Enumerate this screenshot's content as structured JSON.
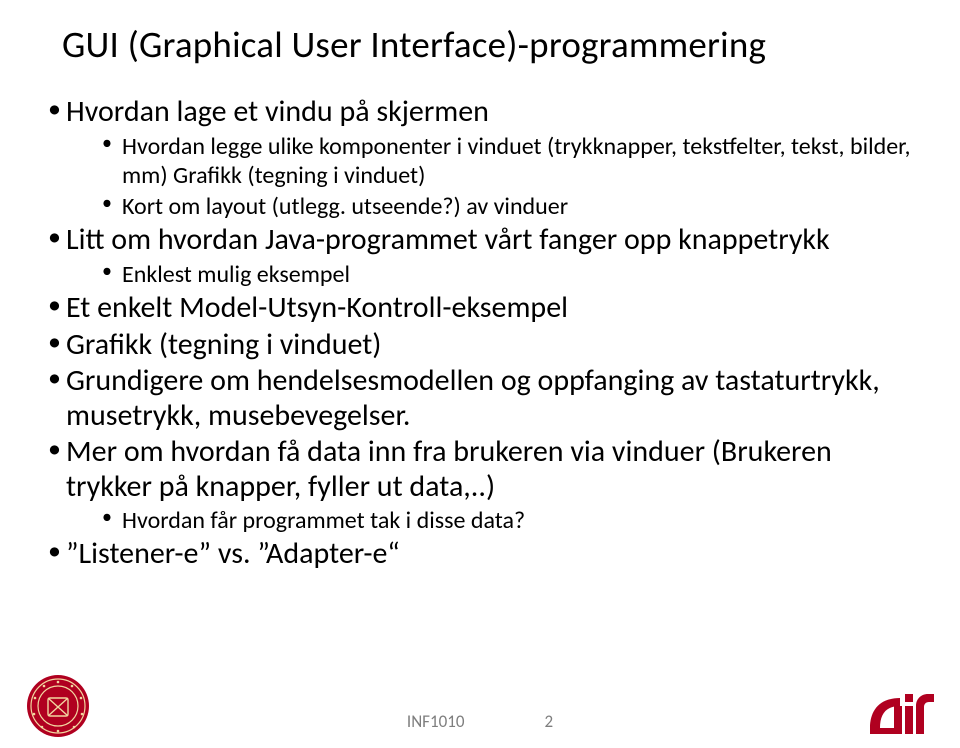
{
  "title": "GUI (Graphical User Interface)-programmering",
  "bullets": [
    {
      "text": "Hvordan lage et vindu på skjermen",
      "sub": [
        "Hvordan legge ulike komponenter i vinduet (trykknapper, tekstfelter, tekst, bilder, mm) Grafikk (tegning i vinduet)",
        "Kort om layout (utlegg. utseende?) av vinduer"
      ]
    },
    {
      "text": "Litt om hvordan Java-programmet vårt fanger opp knappetrykk",
      "sub": [
        "Enklest mulig eksempel"
      ]
    },
    {
      "text": "Et enkelt Model-Utsyn-Kontroll-eksempel",
      "sub": []
    },
    {
      "text": "Grafikk (tegning i vinduet)",
      "sub": []
    },
    {
      "text": "Grundigere om hendelsesmodellen og oppfanging av tastaturtrykk, musetrykk, musebevegelser.",
      "sub": []
    },
    {
      "text": "Mer om hvordan få data inn fra brukeren via vinduer (Brukeren trykker på knapper, fyller ut data,..)",
      "sub": [
        "Hvordan får programmet tak i disse data?"
      ]
    },
    {
      "text": "”Listener-e” vs. ”Adapter-e“",
      "sub": []
    }
  ],
  "footer": {
    "course": "INF1010",
    "page": "2"
  },
  "icons": {
    "seal_bg": "#b00020",
    "seal_fg": "#f2d6a0",
    "ifi_color": "#b00020"
  }
}
